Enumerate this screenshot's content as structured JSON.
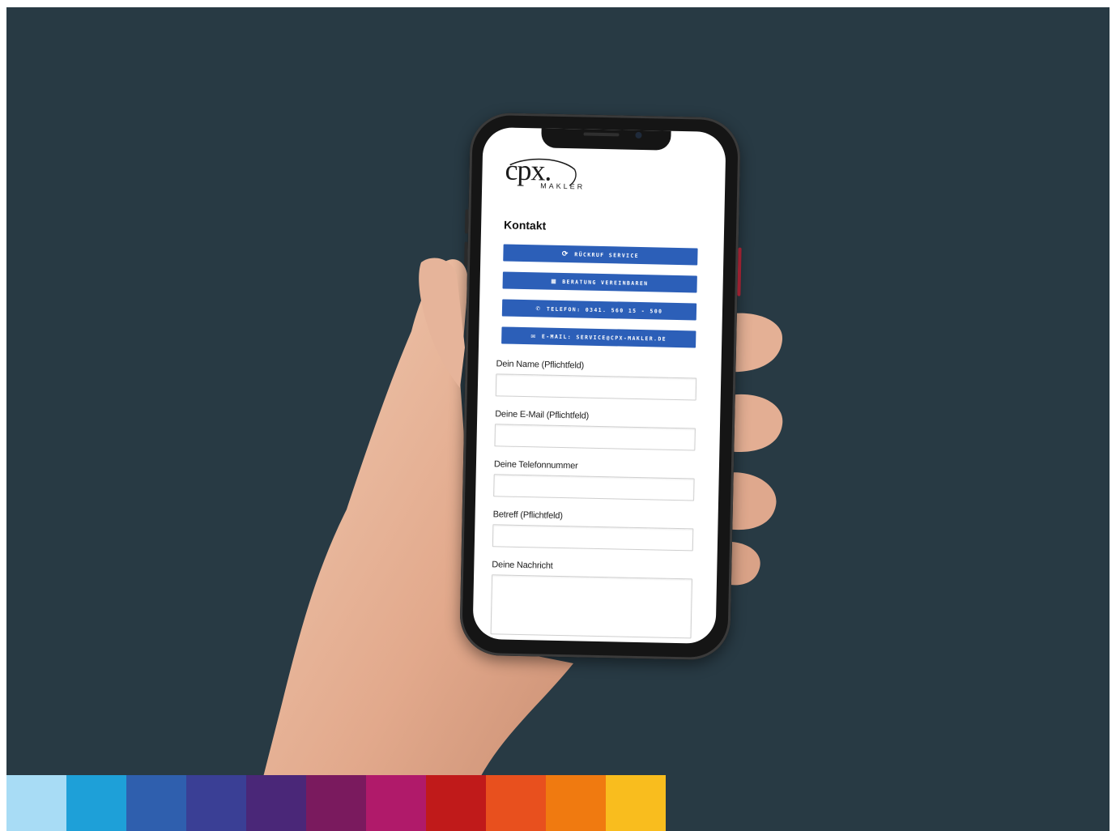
{
  "brand": {
    "logo_primary": "cpx.",
    "logo_secondary": "MAKLER"
  },
  "page": {
    "heading": "Kontakt"
  },
  "buttons": [
    {
      "label": "RÜCKRUF SERVICE",
      "icon": "callback-icon"
    },
    {
      "label": "BERATUNG VEREINBAREN",
      "icon": "calendar-icon"
    },
    {
      "label": "TELEFON: 0341. 560 15 - 500",
      "icon": "phone-icon"
    },
    {
      "label": "E-MAIL: SERVICE@CPX-MAKLER.DE",
      "icon": "mail-icon"
    }
  ],
  "form": {
    "name_label": "Dein Name (Pflichtfeld)",
    "email_label": "Deine E-Mail (Pflichtfeld)",
    "phone_label": "Deine Telefonnummer",
    "subject_label": "Betreff (Pflichtfeld)",
    "message_label": "Deine Nachricht",
    "name_value": "",
    "email_value": "",
    "phone_value": "",
    "subject_value": "",
    "message_value": ""
  },
  "colors": {
    "background": "#283a44",
    "button": "#2c5fb8",
    "palette": [
      "#a8dcf5",
      "#1ea0d8",
      "#2f5fae",
      "#3a3f95",
      "#4a2778",
      "#7a1a5e",
      "#b01a6a",
      "#c01a1a",
      "#e8501e",
      "#f07a10",
      "#f9bd1e"
    ]
  }
}
